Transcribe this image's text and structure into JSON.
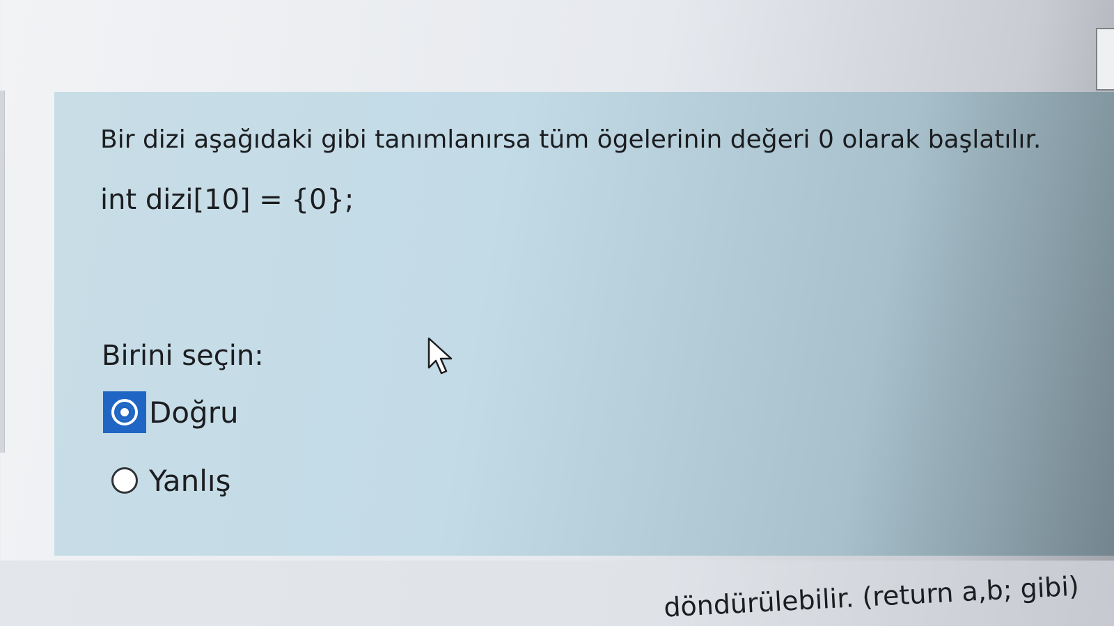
{
  "question": {
    "text": "Bir dizi aşağıdaki gibi tanımlanırsa tüm ögelerinin değeri 0 olarak başlatılır.",
    "code": "int dizi[10] = {0};",
    "prompt": "Birini seçin:",
    "options": [
      {
        "label": "Doğru",
        "selected": true
      },
      {
        "label": "Yanlış",
        "selected": false
      }
    ]
  },
  "next_question": {
    "partial_text": "döndürülebilir. (return a,b; gibi)"
  },
  "colors": {
    "selection_accent": "#1f66c4",
    "question_background": "#c3dbe7"
  }
}
